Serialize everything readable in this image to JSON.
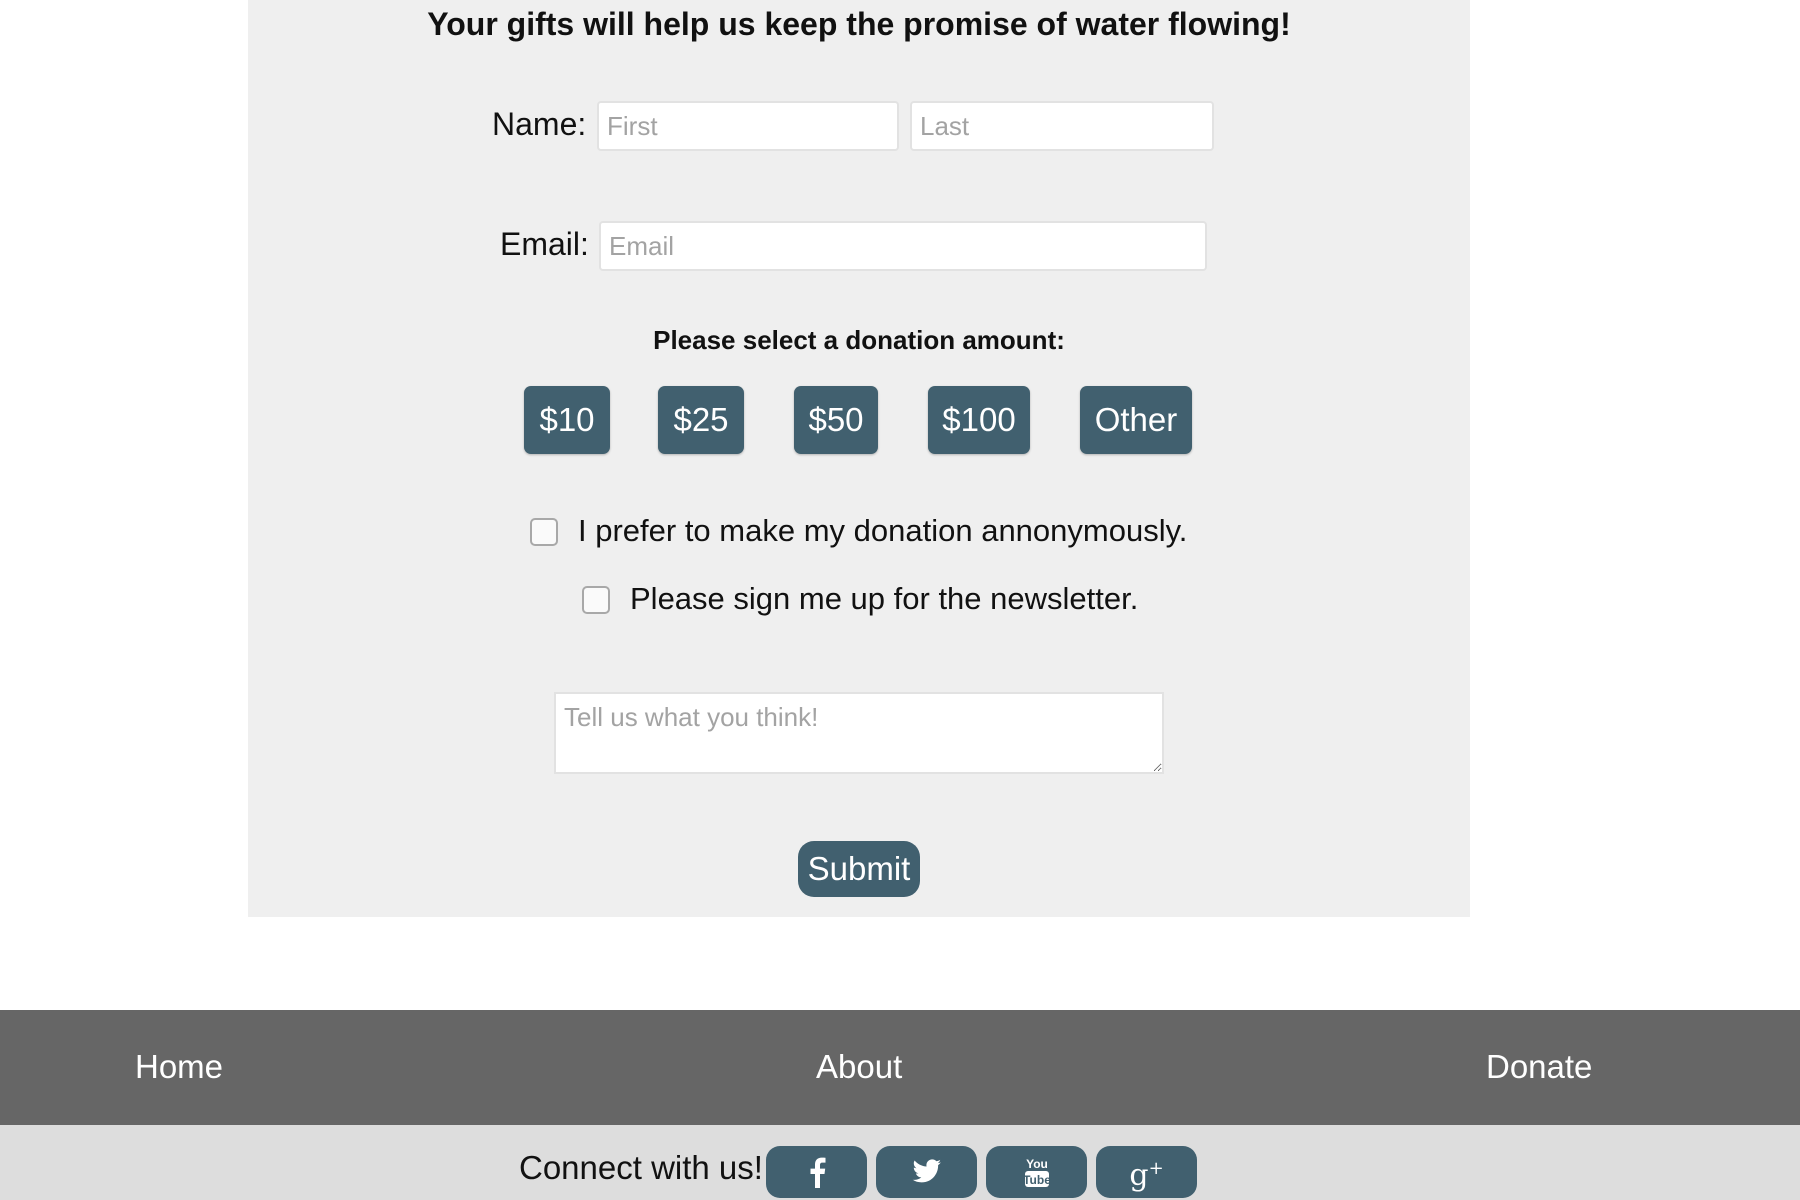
{
  "form": {
    "headline": "Your gifts will help us keep the promise of water flowing!",
    "name_label": "Name:",
    "first_placeholder": "First",
    "last_placeholder": "Last",
    "email_label": "Email:",
    "email_placeholder": "Email",
    "amount_prompt": "Please select a donation amount:",
    "amounts": [
      "$10",
      "$25",
      "$50",
      "$100",
      "Other"
    ],
    "anonymous_label": "I prefer to make my donation annonymously.",
    "anonymous_checked": false,
    "newsletter_label": "Please sign me up for the newsletter.",
    "newsletter_checked": false,
    "comment_placeholder": "Tell us what you think!",
    "submit_label": "Submit"
  },
  "nav": {
    "items": [
      "Home",
      "About",
      "Donate"
    ]
  },
  "social": {
    "connect_text": "Connect with us!",
    "icons": [
      "facebook-icon",
      "twitter-icon",
      "youtube-icon",
      "google-plus-icon"
    ]
  },
  "colors": {
    "button": "#41606f",
    "panel": "#efefef",
    "nav": "#666666",
    "social_bar": "#dddddd"
  }
}
